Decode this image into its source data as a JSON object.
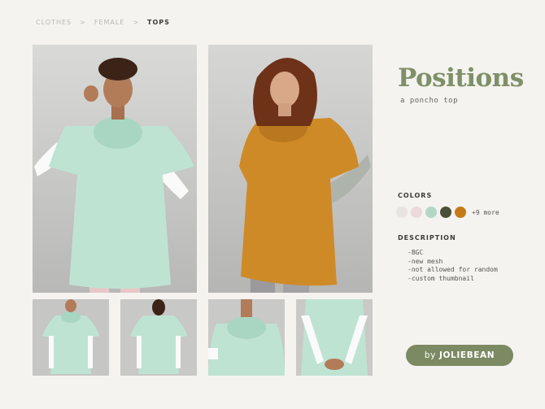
{
  "breadcrumb": {
    "items": [
      "CLOTHES",
      "FEMALE",
      "TOPS"
    ],
    "separator": ">"
  },
  "title": "Positions",
  "subtitle": "a poncho top",
  "colors_label": "COLORS",
  "swatches": [
    "#e8e5e1",
    "#ecd9da",
    "#b4d6c5",
    "#4a4f38",
    "#c67a16"
  ],
  "more_colors": "+9 more",
  "description_label": "DESCRIPTION",
  "description": [
    "-BGC",
    "-new mesh",
    "-not allowed for random",
    "-custom thumbnail"
  ],
  "author": {
    "prefix": "by",
    "name": "JOLIEBEAN"
  },
  "palette": {
    "mint": "#bfe3d3",
    "mustard": "#cf8a28",
    "accent": "#7f9068"
  }
}
